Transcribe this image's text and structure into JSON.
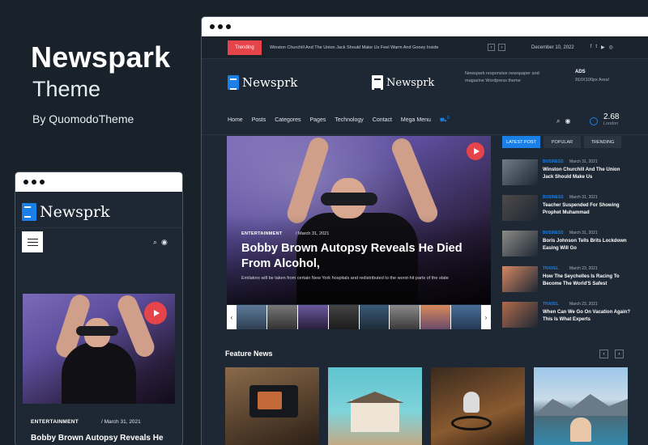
{
  "promo": {
    "title": "Newspark",
    "subtitle": "Theme",
    "byline": "By QuomodoTheme"
  },
  "desktop": {
    "topbar": {
      "trending_label": "Trending",
      "trending_text": "Winston Churchill And The Union Jack Should Make Us Feel Warm And Gooey Inside",
      "date": "December 10, 2022",
      "social_icons": [
        "facebook-icon",
        "twitter-icon",
        "youtube-icon",
        "instagram-icon"
      ]
    },
    "header": {
      "logo_text": "Newsprk",
      "logo2_text": "Newsprk",
      "promo_text": "Newspark responsive newspaper and magazine Wordpress theme",
      "ads_title": "ADS",
      "ads_sub": "910X100px Area!"
    },
    "nav": {
      "items": [
        "Home",
        "Posts",
        "Categores",
        "Pages",
        "Technology",
        "Contact",
        "Mega Menu"
      ],
      "cart_count": "0",
      "weather_temp": "2.68",
      "weather_city": "London"
    },
    "featured": {
      "category": "ENTERTAINMENT",
      "date": "March 31, 2021",
      "title": "Bobby Brown Autopsy Reveals He Died From Alcohol,",
      "description": "Emilators will be taken from certain New York hospitals and redistributed to the worst-hit parts of the state"
    },
    "tabs": [
      "LATEST POST",
      "POPULAR",
      "TRENDING"
    ],
    "posts": [
      {
        "category": "BUSINESS",
        "date": "March 31, 2021",
        "title": "Winston Churchill And The Union Jack Should Make Us",
        "color": "#6f7c86"
      },
      {
        "category": "BUSINESS",
        "date": "March 31, 2021",
        "title": "Teacher Suspended For Showing Prophet Muhammad",
        "color": "#4e4a48"
      },
      {
        "category": "BUSINESS",
        "date": "March 31, 2021",
        "title": "Boris Johnson Tells Brits Lockdown Easing Will Go",
        "color": "#8d8b86"
      },
      {
        "category": "TRAVEL",
        "date": "March 23, 2021",
        "title": "How The Seychelles Is Racing To Become The World'S Safest",
        "color": "#d48763"
      },
      {
        "category": "TRAVEL",
        "date": "March 23, 2021",
        "title": "When Can We Go On Vacation Again? This Is What Experts",
        "color": "#b06b4c"
      }
    ],
    "section_title": "Feature News"
  },
  "mobile": {
    "logo_text": "Newsprk",
    "category": "ENTERTAINMENT",
    "date": "March 31, 2021",
    "title": "Bobby Brown Autopsy Reveals He"
  }
}
